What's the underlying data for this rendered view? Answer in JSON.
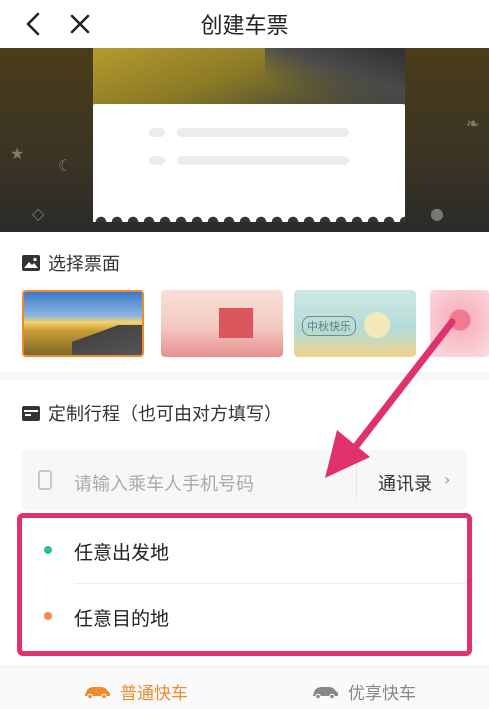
{
  "header": {
    "title": "创建车票",
    "back_icon": "chevron-left-icon",
    "close_icon": "close-icon"
  },
  "ticket_section": {
    "title": "选择票面",
    "icon": "image-icon"
  },
  "thumbnails": [
    {
      "name": "sunset-road-theme",
      "selected": true
    },
    {
      "name": "national-day-theme",
      "selected": false
    },
    {
      "name": "mid-autumn-theme",
      "tag": "中秋快乐",
      "selected": false
    },
    {
      "name": "hearts-theme",
      "selected": false
    }
  ],
  "itinerary_section": {
    "title": "定制行程（也可由对方填写）",
    "icon": "calendar-icon"
  },
  "phone": {
    "placeholder": "请输入乘车人手机号码",
    "contacts_label": "通讯录",
    "chevron": "›"
  },
  "places": {
    "departure": "任意出发地",
    "destination": "任意目的地"
  },
  "service": {
    "standard": "普通快车",
    "premium": "优享快车"
  },
  "colors": {
    "accent": "#f08a2e",
    "highlight": "#e0306e",
    "departure_dot": "#2fbf8a",
    "destination_dot": "#f08a4a"
  }
}
